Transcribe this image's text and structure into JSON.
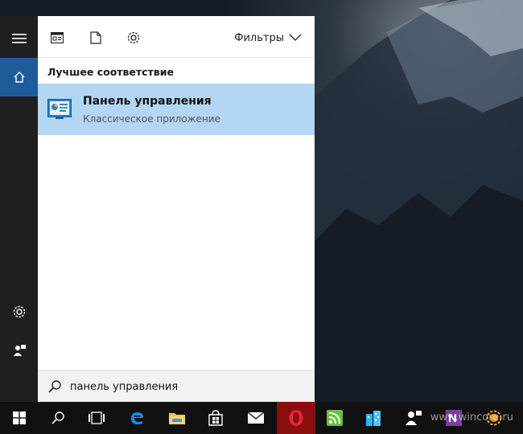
{
  "start_menu": {
    "toolbar": {
      "filters_label": "Фильтры"
    },
    "section_title": "Лучшее соответствие",
    "best_match": {
      "title": "Панель управления",
      "subtitle": "Классическое приложение"
    },
    "search": {
      "value": "панель управления"
    }
  },
  "taskbar": {
    "watermark": "www.wincore.ru"
  },
  "colors": {
    "rail_bg": "#1f1f1f",
    "rail_active": "#1e5b9b",
    "result_highlight": "#b3d7f2",
    "taskbar_bg": "#101010",
    "opera_bg": "#8b0e0e"
  }
}
